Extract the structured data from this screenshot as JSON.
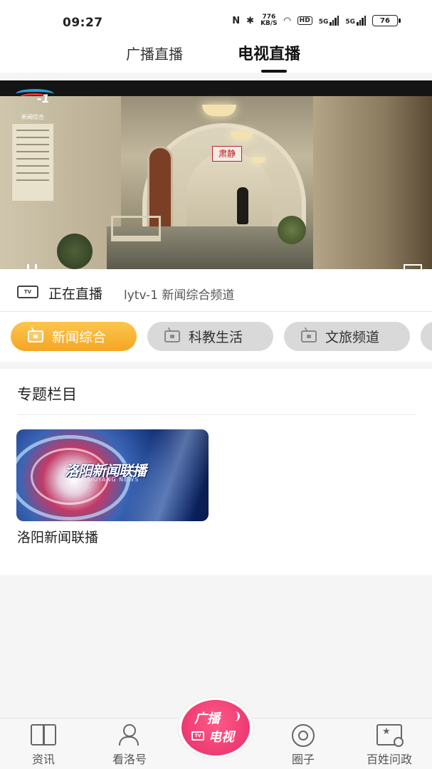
{
  "status_bar": {
    "time": "09:27",
    "net_speed_top": "776",
    "net_speed_bottom": "KB/S",
    "hd": "HD",
    "sig1": "5G",
    "sig2": "5G",
    "battery": "76"
  },
  "top_tabs": [
    {
      "label": "广播直播",
      "active": false
    },
    {
      "label": "电视直播",
      "active": true
    }
  ],
  "video": {
    "logo_text": "-1",
    "logo_caption": "新闻综合",
    "sign_text": "肃静"
  },
  "live": {
    "icon_text": "TV",
    "label": "正在直播",
    "channel": "lytv-1 新闻综合频道"
  },
  "channels": [
    {
      "label": "新闻综合",
      "active": true
    },
    {
      "label": "科教生活",
      "active": false
    },
    {
      "label": "文旅频道",
      "active": false
    }
  ],
  "special": {
    "title": "专题栏目",
    "cards": [
      {
        "title": "洛阳新闻联播",
        "image_title": "洛阳新闻联播",
        "image_subtitle": "LUOYANG NEWS"
      }
    ]
  },
  "bottom_nav": {
    "items": [
      {
        "label": "资讯",
        "icon": "book-icon"
      },
      {
        "label": "看洛号",
        "icon": "user-follow-icon"
      },
      {
        "label": "圈子",
        "icon": "circle-icon"
      },
      {
        "label": "百姓问政",
        "icon": "badge-search-icon"
      }
    ],
    "center": {
      "line1": "广播",
      "line2": "电视",
      "icon_text": "TV"
    }
  },
  "colors": {
    "accent_orange": "#f5a623",
    "accent_pink": "#e52d6a"
  }
}
